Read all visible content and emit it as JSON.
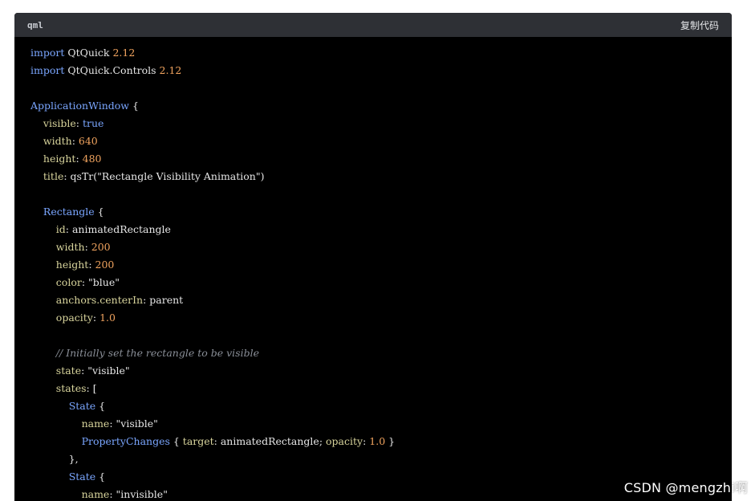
{
  "header": {
    "language": "qml",
    "copy_label": "复制代码"
  },
  "code_lines": [
    [
      [
        "kw",
        "import"
      ],
      [
        "t",
        " QtQuick "
      ],
      [
        "num",
        "2.12"
      ]
    ],
    [
      [
        "kw",
        "import"
      ],
      [
        "t",
        " QtQuick.Controls "
      ],
      [
        "num",
        "2.12"
      ]
    ],
    [],
    [
      [
        "kw",
        "ApplicationWindow"
      ],
      [
        "t",
        " {"
      ]
    ],
    [
      [
        "t",
        "    "
      ],
      [
        "prop",
        "visible"
      ],
      [
        "t",
        ": "
      ],
      [
        "kw",
        "true"
      ]
    ],
    [
      [
        "t",
        "    "
      ],
      [
        "prop",
        "width"
      ],
      [
        "t",
        ": "
      ],
      [
        "num",
        "640"
      ]
    ],
    [
      [
        "t",
        "    "
      ],
      [
        "prop",
        "height"
      ],
      [
        "t",
        ": "
      ],
      [
        "num",
        "480"
      ]
    ],
    [
      [
        "t",
        "    "
      ],
      [
        "prop",
        "title"
      ],
      [
        "t",
        ": qsTr(\"Rectangle Visibility Animation\")"
      ]
    ],
    [],
    [
      [
        "t",
        "    "
      ],
      [
        "kw",
        "Rectangle"
      ],
      [
        "t",
        " {"
      ]
    ],
    [
      [
        "t",
        "        "
      ],
      [
        "prop",
        "id"
      ],
      [
        "t",
        ": animatedRectangle"
      ]
    ],
    [
      [
        "t",
        "        "
      ],
      [
        "prop",
        "width"
      ],
      [
        "t",
        ": "
      ],
      [
        "num",
        "200"
      ]
    ],
    [
      [
        "t",
        "        "
      ],
      [
        "prop",
        "height"
      ],
      [
        "t",
        ": "
      ],
      [
        "num",
        "200"
      ]
    ],
    [
      [
        "t",
        "        "
      ],
      [
        "prop",
        "color"
      ],
      [
        "t",
        ": \"blue\""
      ]
    ],
    [
      [
        "t",
        "        "
      ],
      [
        "prop",
        "anchors.centerIn"
      ],
      [
        "t",
        ": parent"
      ]
    ],
    [
      [
        "t",
        "        "
      ],
      [
        "prop",
        "opacity"
      ],
      [
        "t",
        ": "
      ],
      [
        "num",
        "1.0"
      ]
    ],
    [],
    [
      [
        "t",
        "        "
      ],
      [
        "cmt",
        "// Initially set the rectangle to be visible"
      ]
    ],
    [
      [
        "t",
        "        "
      ],
      [
        "prop",
        "state"
      ],
      [
        "t",
        ": \"visible\""
      ]
    ],
    [
      [
        "t",
        "        "
      ],
      [
        "prop",
        "states"
      ],
      [
        "t",
        ": ["
      ]
    ],
    [
      [
        "t",
        "            "
      ],
      [
        "kw",
        "State"
      ],
      [
        "t",
        " {"
      ]
    ],
    [
      [
        "t",
        "                "
      ],
      [
        "prop",
        "name"
      ],
      [
        "t",
        ": \"visible\""
      ]
    ],
    [
      [
        "t",
        "                "
      ],
      [
        "kw",
        "PropertyChanges"
      ],
      [
        "t",
        " { "
      ],
      [
        "prop",
        "target"
      ],
      [
        "t",
        ": animatedRectangle; "
      ],
      [
        "prop",
        "opacity"
      ],
      [
        "t",
        ": "
      ],
      [
        "num",
        "1.0"
      ],
      [
        "t",
        " }"
      ]
    ],
    [
      [
        "t",
        "            },"
      ]
    ],
    [
      [
        "t",
        "            "
      ],
      [
        "kw",
        "State"
      ],
      [
        "t",
        " {"
      ]
    ],
    [
      [
        "t",
        "                "
      ],
      [
        "prop",
        "name"
      ],
      [
        "t",
        ": \"invisible\""
      ]
    ]
  ],
  "watermark": "CSDN @mengzhi啊",
  "colors": {
    "background": "#000000",
    "header": "#2e3035",
    "keyword": "#7aa6ff",
    "number": "#f0a35e",
    "property": "#d8d49c",
    "comment": "#8a8f98"
  }
}
